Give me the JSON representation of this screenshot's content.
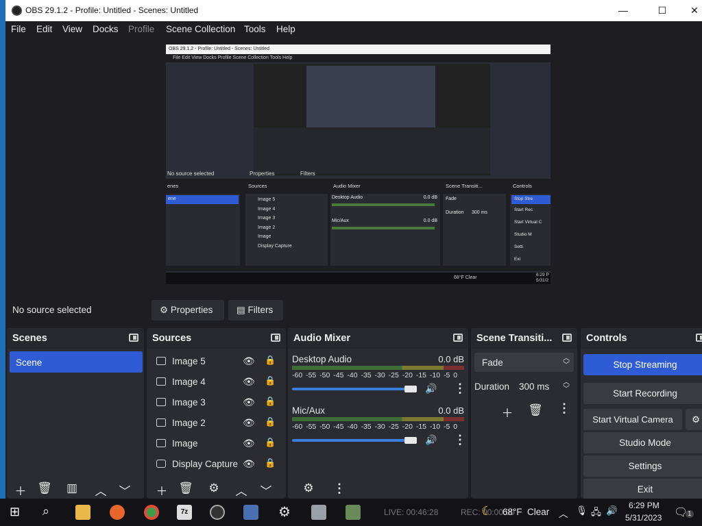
{
  "window": {
    "title": "OBS 29.1.2 - Profile: Untitled - Scenes: Untitled",
    "minimize": "—",
    "maximize": "☐",
    "close": "✕"
  },
  "menu": [
    "File",
    "Edit",
    "View",
    "Docks",
    "Profile",
    "Scene Collection",
    "Tools",
    "Help"
  ],
  "preview": {
    "title": "OBS 29.1.2 - Profile: Untitled - Scenes: Untitled",
    "menu": "File   Edit   View   Docks   Profile   Scene Collection   Tools   Help",
    "no_source": "No source selected",
    "properties": "Properties",
    "filters": "Filters",
    "scenes_header": "enes",
    "scene_item": "ene",
    "sources_header": "Sources",
    "sources": [
      "Image 5",
      "Image 4",
      "Image 3",
      "Image 2",
      "Image",
      "Display Capture"
    ],
    "mixer_header": "Audio Mixer",
    "desktop_audio": "Desktop Audio",
    "mic": "Mic/Aux",
    "db": "0.0 dB",
    "transitions_header": "Scene Transiti...",
    "fade": "Fade",
    "duration": "Duration",
    "duration_value": "300 ms",
    "controls_header": "Controls",
    "controls": [
      "Stop Stre",
      "Start Rec",
      "Start Virtual C",
      "Studio M",
      "Setti",
      "Exi"
    ],
    "weather": "68°F  Clear",
    "time": "6:29 P",
    "date": "5/31/2"
  },
  "source_bar": {
    "no_source": "No source selected",
    "properties": "Properties",
    "filters": "Filters"
  },
  "scenes": {
    "title": "Scenes",
    "items": [
      "Scene"
    ]
  },
  "sources": {
    "title": "Sources",
    "items": [
      "Image 5",
      "Image 4",
      "Image 3",
      "Image 2",
      "Image",
      "Display Capture"
    ]
  },
  "mixer": {
    "title": "Audio Mixer",
    "channels": [
      {
        "name": "Desktop Audio",
        "level": "0.0 dB",
        "volume": 1.0
      },
      {
        "name": "Mic/Aux",
        "level": "0.0 dB",
        "volume": 1.0
      }
    ],
    "scale": "-60 -55 -50 -45 -40 -35 -30 -25 -20 -15 -10 -5 0"
  },
  "transitions": {
    "title": "Scene Transiti...",
    "type": "Fade",
    "duration_label": "Duration",
    "duration_value": "300 ms"
  },
  "controls": {
    "title": "Controls",
    "stop_streaming": "Stop Streaming",
    "start_recording": "Start Recording",
    "start_virtual_camera": "Start Virtual Camera",
    "studio_mode": "Studio Mode",
    "settings": "Settings",
    "exit": "Exit"
  },
  "taskbar": {
    "weather": "68°F",
    "weather_desc": "Clear",
    "time": "6:29 PM",
    "date": "5/31/2023",
    "notification_count": "1",
    "obs_status": "LIVE: 00:46:28",
    "rec_status": "REC: 00:00:00"
  },
  "colors": {
    "accent": "#2f5cd4",
    "panel": "#2b2c31",
    "background": "#1e1e22"
  }
}
